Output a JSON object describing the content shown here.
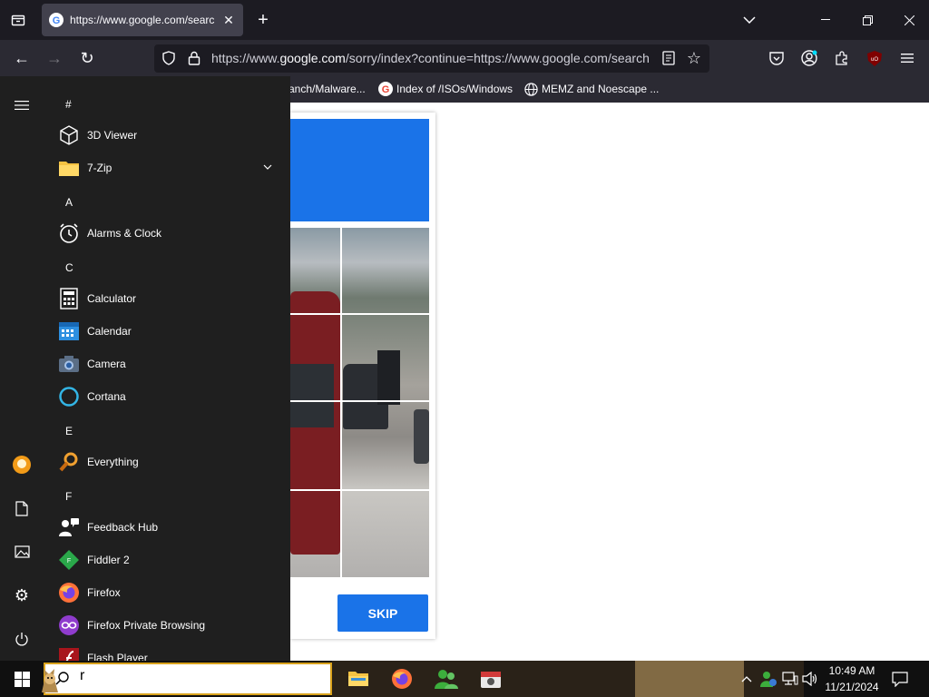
{
  "browser": {
    "tab_title": "https://www.google.com/searc",
    "url_prefix": "https://www.",
    "url_domain": "google.com",
    "url_rest": "/sorry/index?continue=https://www.google.com/search",
    "bookmarks": [
      {
        "label": "anch/Malware...",
        "icon": "none"
      },
      {
        "label": "Index of /ISOs/Windows",
        "icon": "google-g-icon"
      },
      {
        "label": "MEMZ and Noescape ...",
        "icon": "globe-icon"
      }
    ]
  },
  "captcha": {
    "skip_label": "SKIP",
    "colors": {
      "header": "#1a73e8",
      "button": "#1a73e8"
    }
  },
  "start_menu": {
    "sections": [
      {
        "letter": "#",
        "apps": [
          {
            "label": "3D Viewer",
            "icon": "cube-icon"
          },
          {
            "label": "7-Zip",
            "icon": "folder-icon",
            "expandable": true
          }
        ]
      },
      {
        "letter": "A",
        "apps": [
          {
            "label": "Alarms & Clock",
            "icon": "alarm-clock-icon"
          }
        ]
      },
      {
        "letter": "C",
        "apps": [
          {
            "label": "Calculator",
            "icon": "calculator-icon"
          },
          {
            "label": "Calendar",
            "icon": "calendar-icon"
          },
          {
            "label": "Camera",
            "icon": "camera-icon"
          },
          {
            "label": "Cortana",
            "icon": "cortana-icon"
          }
        ]
      },
      {
        "letter": "E",
        "apps": [
          {
            "label": "Everything",
            "icon": "magnifier-icon"
          }
        ]
      },
      {
        "letter": "F",
        "apps": [
          {
            "label": "Feedback Hub",
            "icon": "feedback-icon"
          },
          {
            "label": "Fiddler 2",
            "icon": "fiddler-icon"
          },
          {
            "label": "Firefox",
            "icon": "firefox-icon"
          },
          {
            "label": "Firefox Private Browsing",
            "icon": "private-browsing-icon"
          },
          {
            "label": "Flash Player",
            "icon": "flash-icon"
          }
        ]
      }
    ]
  },
  "taskbar": {
    "search_value": "r",
    "time": "10:49 AM",
    "date": "11/21/2024"
  }
}
